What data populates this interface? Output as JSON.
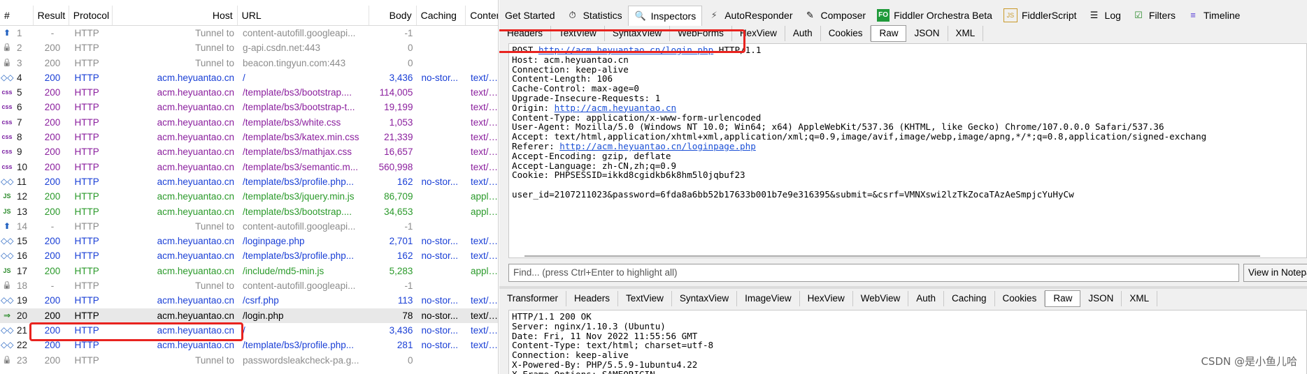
{
  "session_list": {
    "columns": [
      "#",
      "Result",
      "Protocol",
      "Host",
      "URL",
      "Body",
      "Caching",
      "Content"
    ],
    "rows": [
      {
        "num": "1",
        "icon": "tunnel-up-arrow",
        "icon_color": "#1f5fbf",
        "result": "-",
        "protocol": "HTTP",
        "host": "Tunnel to",
        "url": "content-autofill.googleapi...",
        "body": "-1",
        "caching": "",
        "content": "",
        "style": "gray"
      },
      {
        "num": "2",
        "icon": "lock",
        "icon_color": "#9a9a9a",
        "result": "200",
        "protocol": "HTTP",
        "host": "Tunnel to",
        "url": "g-api.csdn.net:443",
        "body": "0",
        "caching": "",
        "content": "",
        "style": "gray"
      },
      {
        "num": "3",
        "icon": "lock",
        "icon_color": "#9a9a9a",
        "result": "200",
        "protocol": "HTTP",
        "host": "Tunnel to",
        "url": "beacon.tingyun.com:443",
        "body": "0",
        "caching": "",
        "content": "",
        "style": "gray"
      },
      {
        "num": "4",
        "icon": "html-diamond",
        "icon_color": "#1f5fbf",
        "result": "200",
        "protocol": "HTTP",
        "host": "acm.heyuantao.cn",
        "url": "/",
        "body": "3,436",
        "caching": "no-stor...",
        "content": "text/html",
        "style": "blue"
      },
      {
        "num": "5",
        "icon": "css",
        "icon_color": "#7a1fa2",
        "result": "200",
        "protocol": "HTTP",
        "host": "acm.heyuantao.cn",
        "url": "/template/bs3/bootstrap....",
        "body": "114,005",
        "caching": "",
        "content": "text/css",
        "style": "purple"
      },
      {
        "num": "6",
        "icon": "css",
        "icon_color": "#7a1fa2",
        "result": "200",
        "protocol": "HTTP",
        "host": "acm.heyuantao.cn",
        "url": "/template/bs3/bootstrap-t...",
        "body": "19,199",
        "caching": "",
        "content": "text/css",
        "style": "purple"
      },
      {
        "num": "7",
        "icon": "css",
        "icon_color": "#7a1fa2",
        "result": "200",
        "protocol": "HTTP",
        "host": "acm.heyuantao.cn",
        "url": "/template/bs3/white.css",
        "body": "1,053",
        "caching": "",
        "content": "text/css",
        "style": "purple"
      },
      {
        "num": "8",
        "icon": "css",
        "icon_color": "#7a1fa2",
        "result": "200",
        "protocol": "HTTP",
        "host": "acm.heyuantao.cn",
        "url": "/template/bs3/katex.min.css",
        "body": "21,339",
        "caching": "",
        "content": "text/css",
        "style": "purple"
      },
      {
        "num": "9",
        "icon": "css",
        "icon_color": "#7a1fa2",
        "result": "200",
        "protocol": "HTTP",
        "host": "acm.heyuantao.cn",
        "url": "/template/bs3/mathjax.css",
        "body": "16,657",
        "caching": "",
        "content": "text/css",
        "style": "purple"
      },
      {
        "num": "10",
        "icon": "css",
        "icon_color": "#7a1fa2",
        "result": "200",
        "protocol": "HTTP",
        "host": "acm.heyuantao.cn",
        "url": "/template/bs3/semantic.m...",
        "body": "560,998",
        "caching": "",
        "content": "text/css",
        "style": "purple"
      },
      {
        "num": "11",
        "icon": "html-diamond",
        "icon_color": "#1f5fbf",
        "result": "200",
        "protocol": "HTTP",
        "host": "acm.heyuantao.cn",
        "url": "/template/bs3/profile.php...",
        "body": "162",
        "caching": "no-stor...",
        "content": "text/html",
        "style": "blue"
      },
      {
        "num": "12",
        "icon": "js",
        "icon_color": "#2a8a2a",
        "result": "200",
        "protocol": "HTTP",
        "host": "acm.heyuantao.cn",
        "url": "/template/bs3/jquery.min.js",
        "body": "86,709",
        "caching": "",
        "content": "application",
        "style": "green"
      },
      {
        "num": "13",
        "icon": "js",
        "icon_color": "#2a8a2a",
        "result": "200",
        "protocol": "HTTP",
        "host": "acm.heyuantao.cn",
        "url": "/template/bs3/bootstrap....",
        "body": "34,653",
        "caching": "",
        "content": "application",
        "style": "green"
      },
      {
        "num": "14",
        "icon": "tunnel-up-arrow",
        "icon_color": "#1f5fbf",
        "result": "-",
        "protocol": "HTTP",
        "host": "Tunnel to",
        "url": "content-autofill.googleapi...",
        "body": "-1",
        "caching": "",
        "content": "",
        "style": "gray"
      },
      {
        "num": "15",
        "icon": "html-diamond",
        "icon_color": "#1f5fbf",
        "result": "200",
        "protocol": "HTTP",
        "host": "acm.heyuantao.cn",
        "url": "/loginpage.php",
        "body": "2,701",
        "caching": "no-stor...",
        "content": "text/html",
        "style": "blue"
      },
      {
        "num": "16",
        "icon": "html-diamond",
        "icon_color": "#1f5fbf",
        "result": "200",
        "protocol": "HTTP",
        "host": "acm.heyuantao.cn",
        "url": "/template/bs3/profile.php...",
        "body": "162",
        "caching": "no-stor...",
        "content": "text/html",
        "style": "blue"
      },
      {
        "num": "17",
        "icon": "js",
        "icon_color": "#2a8a2a",
        "result": "200",
        "protocol": "HTTP",
        "host": "acm.heyuantao.cn",
        "url": "/include/md5-min.js",
        "body": "5,283",
        "caching": "",
        "content": "application",
        "style": "green"
      },
      {
        "num": "18",
        "icon": "lock",
        "icon_color": "#9a9a9a",
        "result": "-",
        "protocol": "HTTP",
        "host": "Tunnel to",
        "url": "content-autofill.googleapi...",
        "body": "-1",
        "caching": "",
        "content": "",
        "style": "gray"
      },
      {
        "num": "19",
        "icon": "html-diamond",
        "icon_color": "#1f5fbf",
        "result": "200",
        "protocol": "HTTP",
        "host": "acm.heyuantao.cn",
        "url": "/csrf.php",
        "body": "113",
        "caching": "no-stor...",
        "content": "text/html",
        "style": "blue"
      },
      {
        "num": "20",
        "icon": "post-arrow",
        "icon_color": "#2a8a2a",
        "result": "200",
        "protocol": "HTTP",
        "host": "acm.heyuantao.cn",
        "url": "/login.php",
        "body": "78",
        "caching": "no-stor...",
        "content": "text/html",
        "style": "black",
        "selected": true
      },
      {
        "num": "21",
        "icon": "html-diamond",
        "icon_color": "#1f5fbf",
        "result": "200",
        "protocol": "HTTP",
        "host": "acm.heyuantao.cn",
        "url": "/",
        "body": "3,436",
        "caching": "no-stor...",
        "content": "text/html",
        "style": "blue"
      },
      {
        "num": "22",
        "icon": "html-diamond",
        "icon_color": "#1f5fbf",
        "result": "200",
        "protocol": "HTTP",
        "host": "acm.heyuantao.cn",
        "url": "/template/bs3/profile.php...",
        "body": "281",
        "caching": "no-stor...",
        "content": "text/html",
        "style": "blue"
      },
      {
        "num": "23",
        "icon": "lock",
        "icon_color": "#9a9a9a",
        "result": "200",
        "protocol": "HTTP",
        "host": "Tunnel to",
        "url": "passwordsleakcheck-pa.g...",
        "body": "0",
        "caching": "",
        "content": "",
        "style": "gray"
      }
    ]
  },
  "colors": {
    "gray": "#8c8c8c",
    "blue": "#1a3fd6",
    "purple": "#8b1f9e",
    "green": "#2a9a2a",
    "black": "#000000",
    "highlight": "#e8231f"
  },
  "top_tabs": [
    {
      "label": "Get Started",
      "icon": ""
    },
    {
      "label": "Statistics",
      "icon": "stopwatch-icon"
    },
    {
      "label": "Inspectors",
      "icon": "inspectors-icon",
      "active": true
    },
    {
      "label": "AutoResponder",
      "icon": "lightning-icon"
    },
    {
      "label": "Composer",
      "icon": "pencil-icon"
    },
    {
      "label": "Fiddler Orchestra Beta",
      "icon": "fo-icon"
    },
    {
      "label": "FiddlerScript",
      "icon": "script-icon"
    },
    {
      "label": "Log",
      "icon": "log-icon"
    },
    {
      "label": "Filters",
      "icon": "checkbox-icon"
    },
    {
      "label": "Timeline",
      "icon": "timeline-icon"
    }
  ],
  "request_tabs": [
    "Headers",
    "TextView",
    "SyntaxView",
    "WebForms",
    "HexView",
    "Auth",
    "Cookies",
    "Raw",
    "JSON",
    "XML"
  ],
  "request_active_tab": "Raw",
  "request": {
    "method": "POST",
    "url": "http://acm.heyuantao.cn/login.php",
    "version": "HTTP/1.1",
    "lines_before_origin": [
      "Host: acm.heyuantao.cn",
      "Connection: keep-alive",
      "Content-Length: 106",
      "Cache-Control: max-age=0",
      "Upgrade-Insecure-Requests: 1"
    ],
    "origin_label": "Origin: ",
    "origin_url": "http://acm.heyuantao.cn",
    "lines_mid": [
      "Content-Type: application/x-www-form-urlencoded",
      "User-Agent: Mozilla/5.0 (Windows NT 10.0; Win64; x64) AppleWebKit/537.36 (KHTML, like Gecko) Chrome/107.0.0.0 Safari/537.36",
      "Accept: text/html,application/xhtml+xml,application/xml;q=0.9,image/avif,image/webp,image/apng,*/*;q=0.8,application/signed-exchang"
    ],
    "referer_label": "Referer: ",
    "referer_url": "http://acm.heyuantao.cn/loginpage.php",
    "lines_after": [
      "Accept-Encoding: gzip, deflate",
      "Accept-Language: zh-CN,zh;q=0.9",
      "Cookie: PHPSESSID=ikkd8cgidkb6k8hm5l0jqbuf23"
    ],
    "body": "user_id=2107211023&password=6fda8a6bb52b17633b001b7e9e316395&submit=&csrf=VMNXswi2lzTkZocaTAzAeSmpjcYuHyCw"
  },
  "find_placeholder": "Find... (press Ctrl+Enter to highlight all)",
  "view_notepad_label": "View in Notepad",
  "response_tabs": [
    "Transformer",
    "Headers",
    "TextView",
    "SyntaxView",
    "ImageView",
    "HexView",
    "WebView",
    "Auth",
    "Caching",
    "Cookies",
    "Raw",
    "JSON",
    "XML"
  ],
  "response_active_tab": "Raw",
  "response_lines": [
    "HTTP/1.1 200 OK",
    "Server: nginx/1.10.3 (Ubuntu)",
    "Date: Fri, 11 Nov 2022 11:55:56 GMT",
    "Content-Type: text/html; charset=utf-8",
    "Connection: keep-alive",
    "X-Powered-By: PHP/5.5.9-1ubuntu4.22",
    "X-Frame-Options: SAMEORIGIN"
  ],
  "watermark": "CSDN @是小鱼儿哈"
}
